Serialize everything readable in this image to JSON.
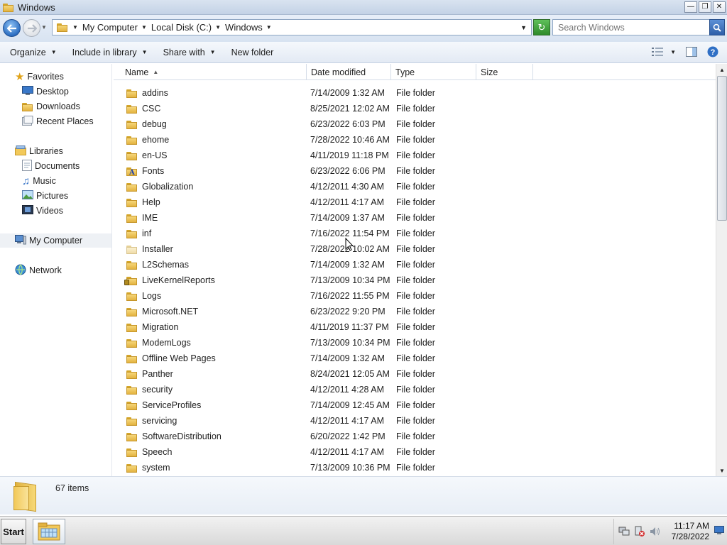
{
  "window": {
    "title": "Windows"
  },
  "address": {
    "crumbs": [
      "My Computer",
      "Local Disk (C:)",
      "Windows"
    ]
  },
  "search": {
    "placeholder": "Search Windows"
  },
  "toolbar": {
    "organize": "Organize",
    "include_in_library": "Include in library",
    "share_with": "Share with",
    "new_folder": "New folder"
  },
  "sidebar": {
    "favorites": {
      "label": "Favorites",
      "items": [
        "Desktop",
        "Downloads",
        "Recent Places"
      ]
    },
    "libraries": {
      "label": "Libraries",
      "items": [
        "Documents",
        "Music",
        "Pictures",
        "Videos"
      ]
    },
    "computer": {
      "label": "My Computer"
    },
    "network": {
      "label": "Network"
    }
  },
  "columns": {
    "name": "Name",
    "date_modified": "Date modified",
    "type": "Type",
    "size": "Size"
  },
  "files": [
    {
      "name": "addins",
      "date": "7/14/2009 1:32 AM",
      "type": "File folder"
    },
    {
      "name": "CSC",
      "date": "8/25/2021 12:02 AM",
      "type": "File folder"
    },
    {
      "name": "debug",
      "date": "6/23/2022 6:03 PM",
      "type": "File folder"
    },
    {
      "name": "ehome",
      "date": "7/28/2022 10:46 AM",
      "type": "File folder"
    },
    {
      "name": "en-US",
      "date": "4/11/2019 11:18 PM",
      "type": "File folder"
    },
    {
      "name": "Fonts",
      "date": "6/23/2022 6:06 PM",
      "type": "File folder"
    },
    {
      "name": "Globalization",
      "date": "4/12/2011 4:30 AM",
      "type": "File folder"
    },
    {
      "name": "Help",
      "date": "4/12/2011 4:17 AM",
      "type": "File folder"
    },
    {
      "name": "IME",
      "date": "7/14/2009 1:37 AM",
      "type": "File folder"
    },
    {
      "name": "inf",
      "date": "7/16/2022 11:54 PM",
      "type": "File folder"
    },
    {
      "name": "Installer",
      "date": "7/28/2022 10:02 AM",
      "type": "File folder"
    },
    {
      "name": "L2Schemas",
      "date": "7/14/2009 1:32 AM",
      "type": "File folder"
    },
    {
      "name": "LiveKernelReports",
      "date": "7/13/2009 10:34 PM",
      "type": "File folder"
    },
    {
      "name": "Logs",
      "date": "7/16/2022 11:55 PM",
      "type": "File folder"
    },
    {
      "name": "Microsoft.NET",
      "date": "6/23/2022 9:20 PM",
      "type": "File folder"
    },
    {
      "name": "Migration",
      "date": "4/11/2019 11:37 PM",
      "type": "File folder"
    },
    {
      "name": "ModemLogs",
      "date": "7/13/2009 10:34 PM",
      "type": "File folder"
    },
    {
      "name": "Offline Web Pages",
      "date": "7/14/2009 1:32 AM",
      "type": "File folder"
    },
    {
      "name": "Panther",
      "date": "8/24/2021 12:05 AM",
      "type": "File folder"
    },
    {
      "name": "security",
      "date": "4/12/2011 4:28 AM",
      "type": "File folder"
    },
    {
      "name": "ServiceProfiles",
      "date": "7/14/2009 12:45 AM",
      "type": "File folder"
    },
    {
      "name": "servicing",
      "date": "4/12/2011 4:17 AM",
      "type": "File folder"
    },
    {
      "name": "SoftwareDistribution",
      "date": "6/20/2022 1:42 PM",
      "type": "File folder"
    },
    {
      "name": "Speech",
      "date": "4/12/2011 4:17 AM",
      "type": "File folder"
    },
    {
      "name": "system",
      "date": "7/13/2009 10:36 PM",
      "type": "File folder"
    }
  ],
  "details": {
    "item_count": "67 items"
  },
  "taskbar": {
    "start": "Start",
    "time": "11:17 AM",
    "date": "7/28/2022"
  }
}
